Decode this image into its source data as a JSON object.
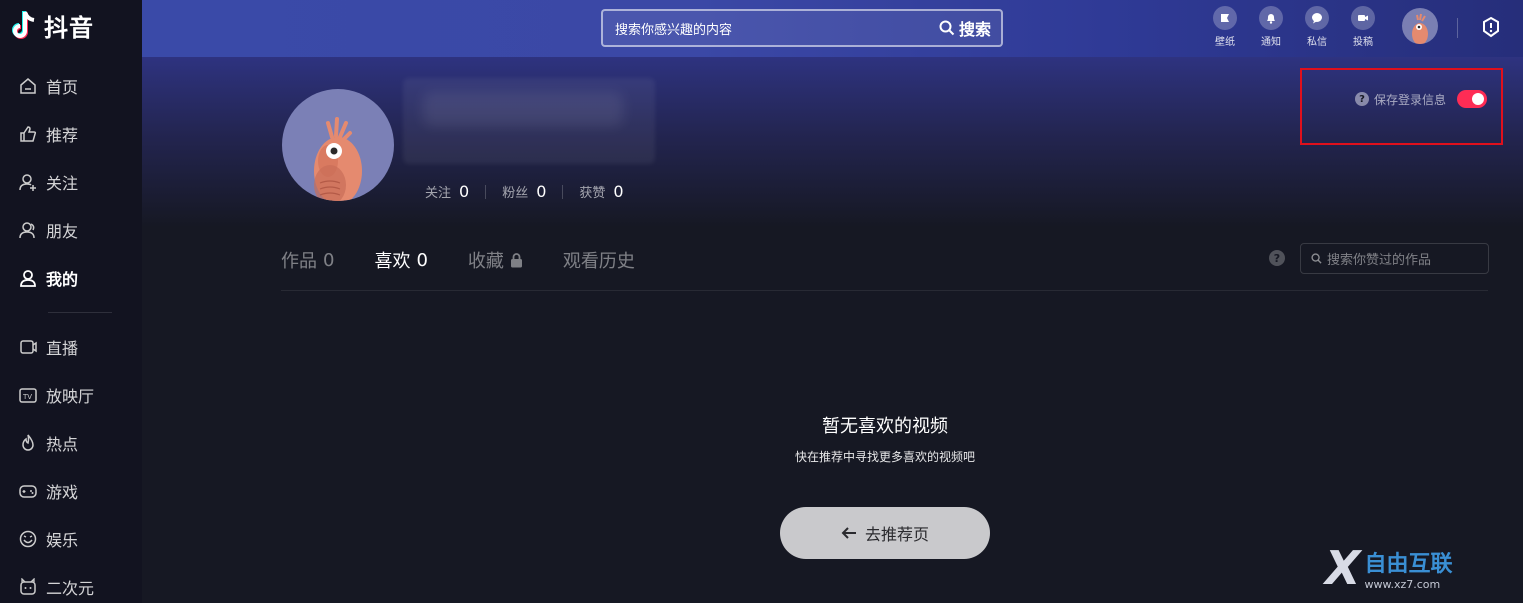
{
  "app": {
    "name": "抖音"
  },
  "sidebar": {
    "items": [
      {
        "label": "首页",
        "icon": "home-icon"
      },
      {
        "label": "推荐",
        "icon": "thumbs-up-icon"
      },
      {
        "label": "关注",
        "icon": "user-plus-icon"
      },
      {
        "label": "朋友",
        "icon": "friends-icon"
      },
      {
        "label": "我的",
        "icon": "user-icon",
        "active": true
      }
    ],
    "items2": [
      {
        "label": "直播",
        "icon": "live-icon"
      },
      {
        "label": "放映厅",
        "icon": "tv-icon"
      },
      {
        "label": "热点",
        "icon": "flame-icon"
      },
      {
        "label": "游戏",
        "icon": "gamepad-icon"
      },
      {
        "label": "娱乐",
        "icon": "smile-icon"
      },
      {
        "label": "二次元",
        "icon": "anime-icon"
      }
    ]
  },
  "header": {
    "search_placeholder": "搜索你感兴趣的内容",
    "search_button": "搜索",
    "icons": [
      {
        "label": "壁纸",
        "icon": "wallpaper-icon"
      },
      {
        "label": "通知",
        "icon": "bell-icon"
      },
      {
        "label": "私信",
        "icon": "message-icon"
      },
      {
        "label": "投稿",
        "icon": "upload-video-icon"
      }
    ]
  },
  "profile": {
    "stats": [
      {
        "label": "关注",
        "value": "0"
      },
      {
        "label": "粉丝",
        "value": "0"
      },
      {
        "label": "获赞",
        "value": "0"
      }
    ],
    "save_login_label": "保存登录信息",
    "save_login_enabled": true
  },
  "tabs": [
    {
      "label": "作品",
      "count": "0"
    },
    {
      "label": "喜欢",
      "count": "0",
      "active": true
    },
    {
      "label": "收藏",
      "count": "",
      "locked": true
    },
    {
      "label": "观看历史",
      "count": ""
    }
  ],
  "liked_search_placeholder": "搜索你赞过的作品",
  "empty": {
    "title": "暂无喜欢的视频",
    "subtitle": "快在推荐中寻找更多喜欢的视频吧",
    "button": "去推荐页"
  },
  "watermark": {
    "cn": "自由互联",
    "url": "www.xz7.com"
  },
  "colors": {
    "accent": "#fe2c55",
    "highlight_box": "#e0101c",
    "background": "#161823"
  }
}
